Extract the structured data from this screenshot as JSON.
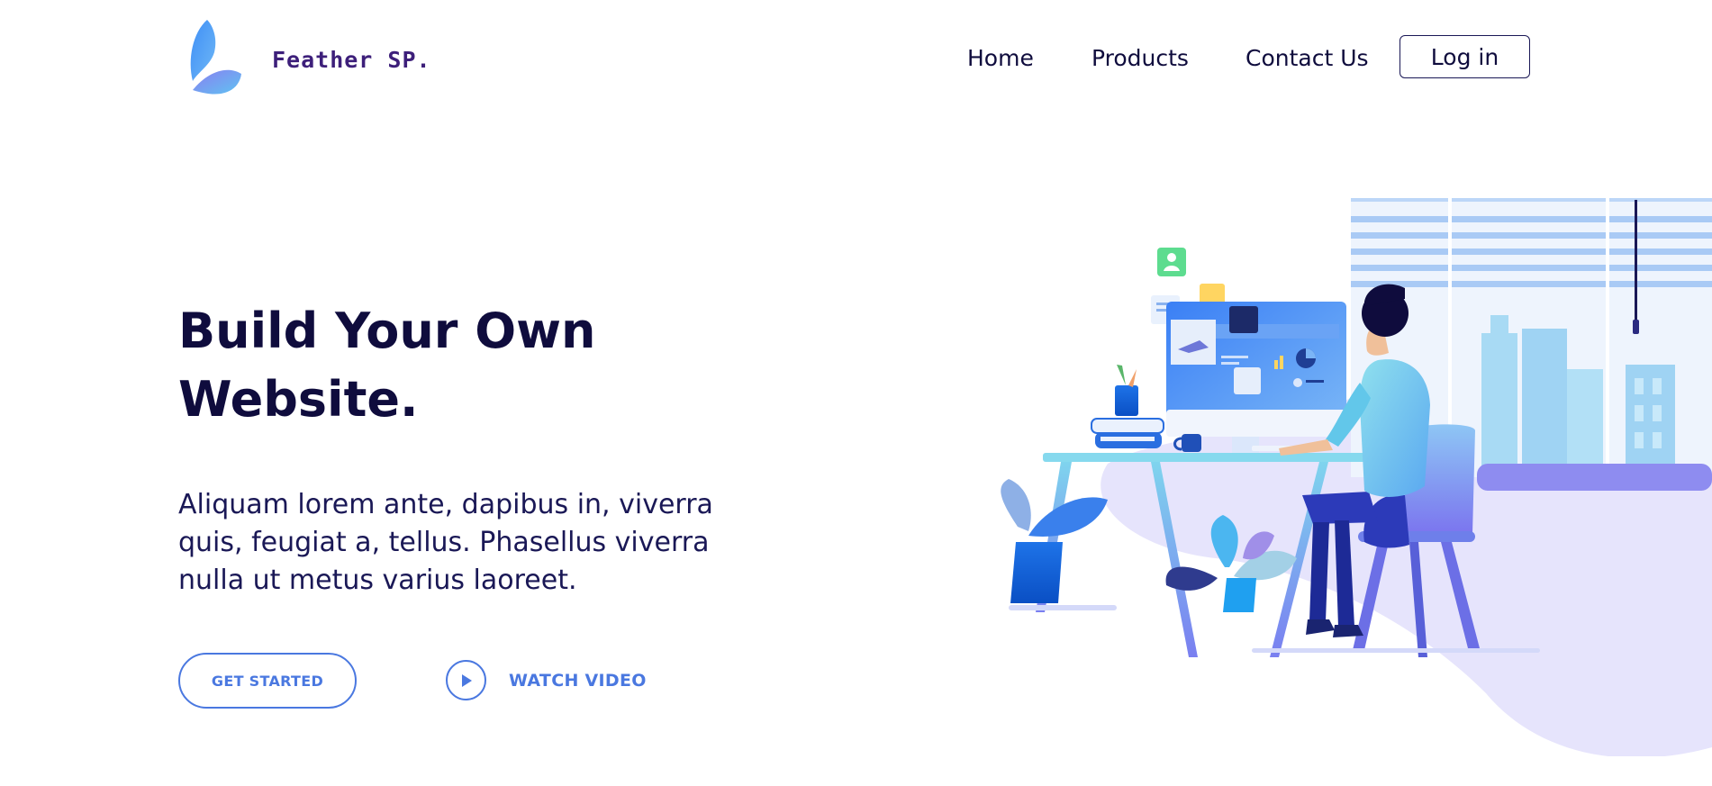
{
  "header": {
    "brand": "Feather SP.",
    "nav": [
      "Home",
      "Products",
      "Contact Us"
    ],
    "login_label": "Log in"
  },
  "hero": {
    "title_line1": "Build Your Own",
    "title_line2": "Website.",
    "text": "Aliquam lorem ante, dapibus in, viverra quis, feugiat a, tellus. Phasellus viverra nulla ut metus varius laoreet.",
    "cta_label": "GET STARTED",
    "video_label": "WATCH VIDEO"
  },
  "colors": {
    "navy": "#0f0c3d",
    "accent_blue": "#4a78e0",
    "brand_purple": "#3d1f7a",
    "lavender": "#e4e2fb"
  },
  "icons": {
    "logo": "feather-leaf-logo",
    "play": "play-icon"
  }
}
